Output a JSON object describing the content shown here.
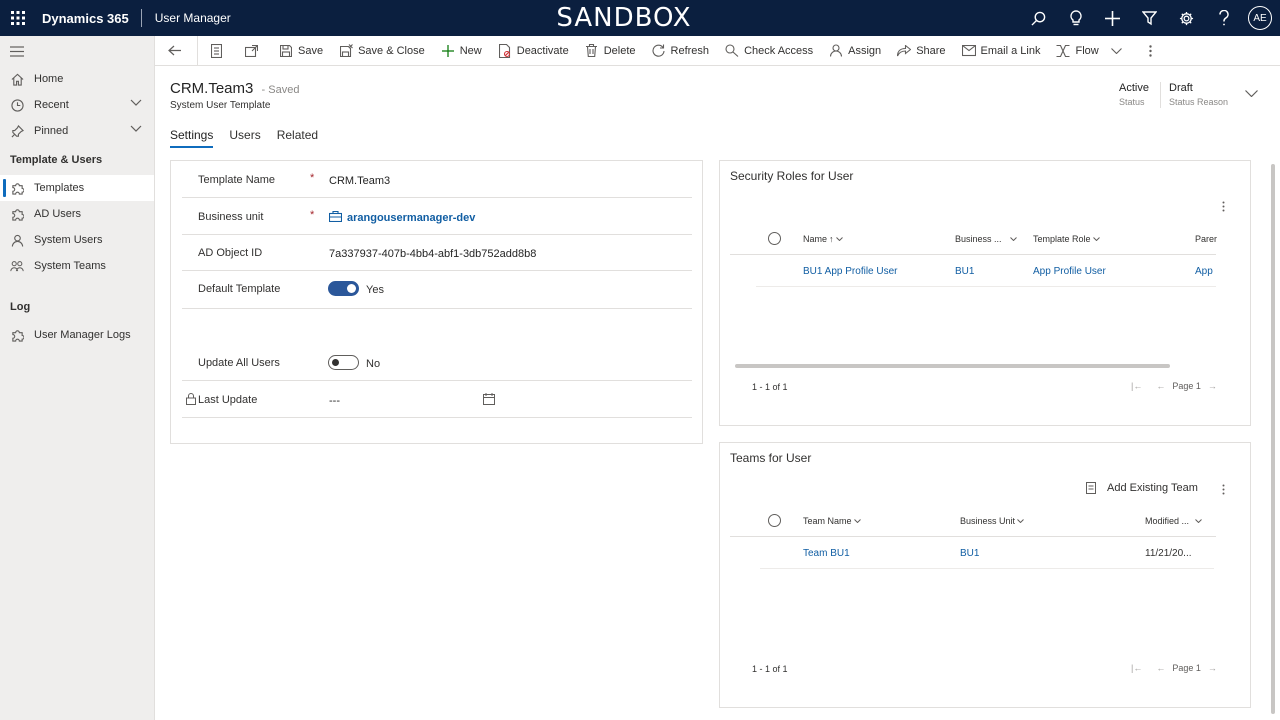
{
  "topbar": {
    "brand": "Dynamics 365",
    "app_name": "User Manager",
    "environment": "SANDBOX",
    "avatar_initials": "AE",
    "icons": [
      "search-icon",
      "lightbulb-icon",
      "plus-icon",
      "filter-icon",
      "settings-icon",
      "help-icon"
    ]
  },
  "sidebar": {
    "items": [
      {
        "label": "Home",
        "icon": "home-icon"
      },
      {
        "label": "Recent",
        "icon": "clock-icon"
      },
      {
        "label": "Pinned",
        "icon": "pin-icon"
      }
    ],
    "sections": [
      {
        "title": "Template & Users",
        "items": [
          {
            "label": "Templates",
            "icon": "puzzle-icon",
            "active": true
          },
          {
            "label": "AD Users",
            "icon": "puzzle-icon"
          },
          {
            "label": "System Users",
            "icon": "person-icon"
          },
          {
            "label": "System Teams",
            "icon": "people-icon"
          }
        ]
      },
      {
        "title": "Log",
        "items": [
          {
            "label": "User Manager Logs",
            "icon": "puzzle-icon"
          }
        ]
      }
    ]
  },
  "commandbar": {
    "save": "Save",
    "save_close": "Save & Close",
    "new": "New",
    "deactivate": "Deactivate",
    "delete": "Delete",
    "refresh": "Refresh",
    "check_access": "Check Access",
    "assign": "Assign",
    "share": "Share",
    "email_link": "Email a Link",
    "flow": "Flow"
  },
  "record": {
    "title": "CRM.Team3",
    "saved": "- Saved",
    "entity": "System User Template",
    "status_value": "Active",
    "status_label": "Status",
    "reason_value": "Draft",
    "reason_label": "Status Reason"
  },
  "tabs": [
    "Settings",
    "Users",
    "Related"
  ],
  "form": {
    "template_name_label": "Template Name",
    "template_name_value": "CRM.Team3",
    "business_unit_label": "Business unit",
    "business_unit_value": "arangousermanager-dev",
    "ad_object_label": "AD Object ID",
    "ad_object_value": "7a337937-407b-4bb4-abf1-3db752add8b8",
    "default_template_label": "Default Template",
    "default_template_value": "Yes",
    "update_all_label": "Update All Users",
    "update_all_value": "No",
    "last_update_label": "Last Update",
    "last_update_value": "---",
    "required_mark": "*"
  },
  "security_roles": {
    "title": "Security Roles for User",
    "columns": [
      "Name",
      "Business ...",
      "Template Role",
      "Parer"
    ],
    "sort_arrow": "↑",
    "rows": [
      {
        "name": "BU1 App Profile User",
        "business": "BU1",
        "template_role": "App Profile User",
        "parent": "App"
      }
    ],
    "count": "1 - 1 of 1",
    "page": "Page 1"
  },
  "teams": {
    "title": "Teams for User",
    "add_existing": "Add Existing Team",
    "columns": [
      "Team Name",
      "Business Unit",
      "Modified ..."
    ],
    "rows": [
      {
        "team": "Team BU1",
        "business": "BU1",
        "modified": "11/21/20..."
      }
    ],
    "count": "1 - 1 of 1",
    "page": "Page 1"
  }
}
